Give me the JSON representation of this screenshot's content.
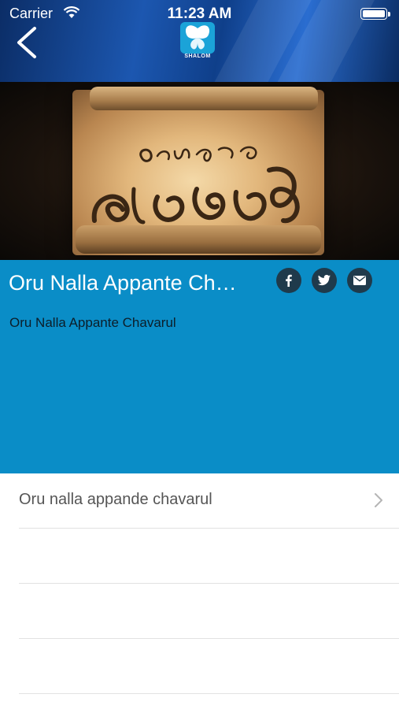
{
  "status_bar": {
    "carrier": "Carrier",
    "time": "11:23 AM"
  },
  "header": {
    "logo_text": "SHALOM"
  },
  "banner": {
    "description": "Oru Nalla Appante Chavarul show artwork on a scroll"
  },
  "panel": {
    "title": "Oru Nalla Appante Ch…",
    "subtitle": "Oru Nalla Appante Chavarul"
  },
  "list": {
    "items": [
      {
        "label": "Oru nalla appande chavarul"
      },
      {
        "label": ""
      },
      {
        "label": ""
      },
      {
        "label": ""
      }
    ]
  },
  "colors": {
    "panel": "#0a8dc7",
    "share_icon_bg": "#1f3a4b",
    "header": "#1c57b0"
  }
}
